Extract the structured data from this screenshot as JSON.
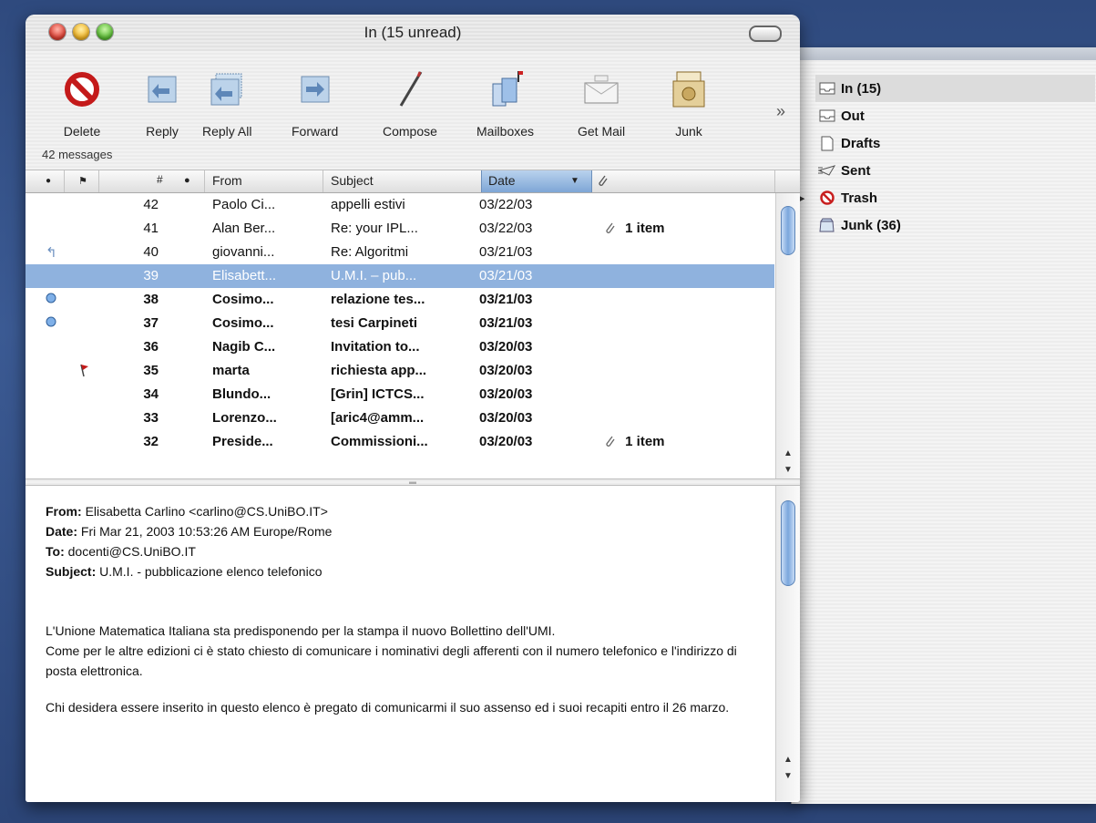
{
  "window": {
    "title": "In (15 unread)"
  },
  "toolbar": {
    "buttons": [
      {
        "label": "Delete",
        "icon": "delete-icon"
      },
      {
        "label": "Reply",
        "icon": "reply-icon"
      },
      {
        "label": "Reply All",
        "icon": "reply-all-icon"
      },
      {
        "label": "Forward",
        "icon": "forward-icon"
      },
      {
        "label": "Compose",
        "icon": "compose-icon"
      },
      {
        "label": "Mailboxes",
        "icon": "mailboxes-icon"
      },
      {
        "label": "Get Mail",
        "icon": "get-mail-icon"
      },
      {
        "label": "Junk",
        "icon": "junk-icon"
      }
    ],
    "more": "»"
  },
  "status": {
    "count": "42 messages"
  },
  "columns": {
    "num": "#",
    "from": "From",
    "subject": "Subject",
    "date": "Date"
  },
  "messages": [
    {
      "num": "42",
      "from": "Paolo Ci...",
      "subject": "appelli estivi",
      "date": "03/22/03",
      "attachment": "",
      "unread": false
    },
    {
      "num": "41",
      "from": "Alan Ber...",
      "subject": "Re: your IPL...",
      "date": "03/22/03",
      "attachment": "1 item",
      "unread": false
    },
    {
      "num": "40",
      "from": "giovanni...",
      "subject": "Re: Algoritmi",
      "date": "03/21/03",
      "attachment": "",
      "unread": false,
      "replied": true
    },
    {
      "num": "39",
      "from": "Elisabett...",
      "subject": "U.M.I. – pub...",
      "date": "03/21/03",
      "attachment": "",
      "selected": true
    },
    {
      "num": "38",
      "from": "Cosimo...",
      "subject": "relazione tes...",
      "date": "03/21/03",
      "attachment": "",
      "unread": true,
      "dot": true
    },
    {
      "num": "37",
      "from": "Cosimo...",
      "subject": "tesi Carpineti",
      "date": "03/21/03",
      "attachment": "",
      "unread": true,
      "dot": true
    },
    {
      "num": "36",
      "from": "Nagib C...",
      "subject": "Invitation to...",
      "date": "03/20/03",
      "attachment": "",
      "unread": true
    },
    {
      "num": "35",
      "from": "marta",
      "subject": "richiesta app...",
      "date": "03/20/03",
      "attachment": "",
      "unread": true,
      "flag": true
    },
    {
      "num": "34",
      "from": "Blundo...",
      "subject": "[Grin] ICTCS...",
      "date": "03/20/03",
      "attachment": "",
      "unread": true
    },
    {
      "num": "33",
      "from": "Lorenzo...",
      "subject": "[aric4@amm...",
      "date": "03/20/03",
      "attachment": "",
      "unread": true
    },
    {
      "num": "32",
      "from": "Preside...",
      "subject": "Commissioni...",
      "date": "03/20/03",
      "attachment": "1 item",
      "unread": true
    }
  ],
  "preview": {
    "from_label": "From:",
    "from": "Elisabetta Carlino <carlino@CS.UniBO.IT>",
    "date_label": "Date:",
    "date": "Fri Mar 21, 2003  10:53:26 AM Europe/Rome",
    "to_label": "To:",
    "to": "docenti@CS.UniBO.IT",
    "subject_label": "Subject:",
    "subject": "U.M.I. - pubblicazione elenco telefonico",
    "body": [
      "L'Unione Matematica Italiana  sta predisponendo per la stampa il nuovo Bollettino dell'UMI.\nCome per le altre edizioni ci è stato chiesto di comunicare i nominativi degli afferenti con il numero telefonico e l'indirizzo di posta elettronica.",
      "Chi  desidera essere inserito in questo elenco è pregato di comunicarmi il suo assenso ed i suoi recapiti entro il 26 marzo."
    ]
  },
  "mailboxes": [
    {
      "label": "In (15)",
      "icon": "inbox-icon",
      "selected": true
    },
    {
      "label": "Out",
      "icon": "outbox-icon"
    },
    {
      "label": "Drafts",
      "icon": "drafts-icon"
    },
    {
      "label": "Sent",
      "icon": "sent-icon"
    },
    {
      "label": "Trash",
      "icon": "trash-icon",
      "expandable": true
    },
    {
      "label": "Junk (36)",
      "icon": "junk-mailbox-icon"
    }
  ],
  "colors": {
    "selection": "#8fb2de",
    "date_header": "#7ea6d6"
  }
}
